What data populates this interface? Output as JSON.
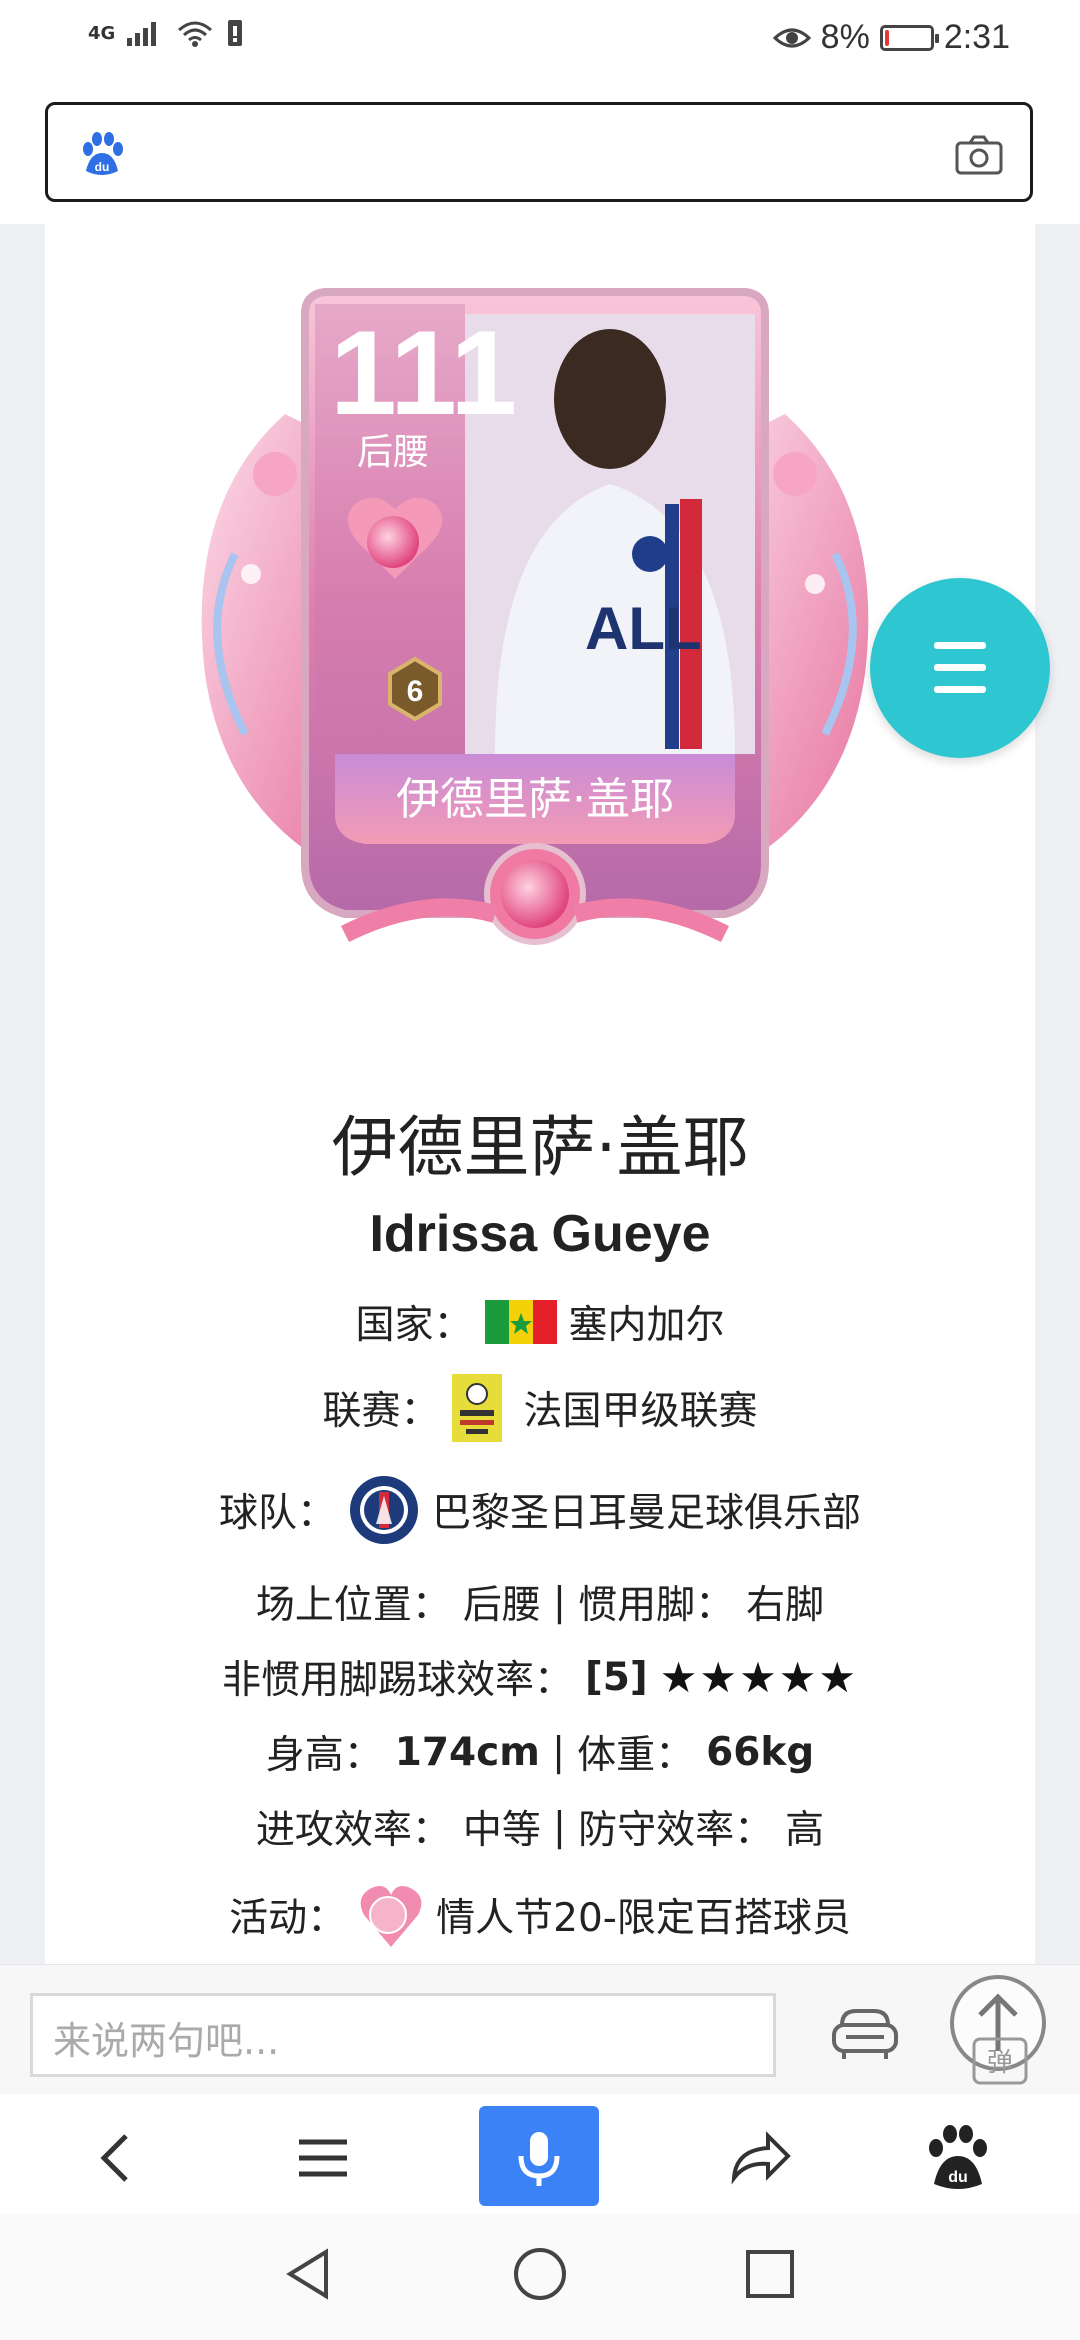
{
  "status_bar": {
    "network": "4G",
    "battery_percent": "8%",
    "time": "2:31"
  },
  "player_card": {
    "rating": "111",
    "position": "后腰",
    "level": "6",
    "card_name": "伊德里萨·盖耶"
  },
  "player": {
    "name_cn": "伊德里萨·盖耶",
    "name_en": "Idrissa Gueye",
    "nation_label": "国家：",
    "nation": "塞内加尔",
    "league_label": "联赛：",
    "league": "法国甲级联赛",
    "team_label": "球队：",
    "team": "巴黎圣日耳曼足球俱乐部",
    "position_label": "场上位置：",
    "position": "后腰",
    "sep": "|",
    "foot_label": "惯用脚：",
    "foot": "右脚",
    "weak_foot_label": "非惯用脚踢球效率：",
    "weak_foot": "[5]",
    "weak_foot_stars": "★★★★★",
    "height_label": "身高：",
    "height": "174cm",
    "weight_label": "体重：",
    "weight": "66kg",
    "attack_label": "进攻效率：",
    "attack": "中等",
    "defense_label": "防守效率：",
    "defense": "高",
    "event_label": "活动：",
    "event": "情人节20-限定百搭球员"
  },
  "comment": {
    "placeholder": "来说两句吧..."
  },
  "top_button": {
    "label": "弹"
  },
  "colors": {
    "fab": "#2ec6d0",
    "mic": "#3b82f6",
    "card_pink": "#f08fb4"
  }
}
